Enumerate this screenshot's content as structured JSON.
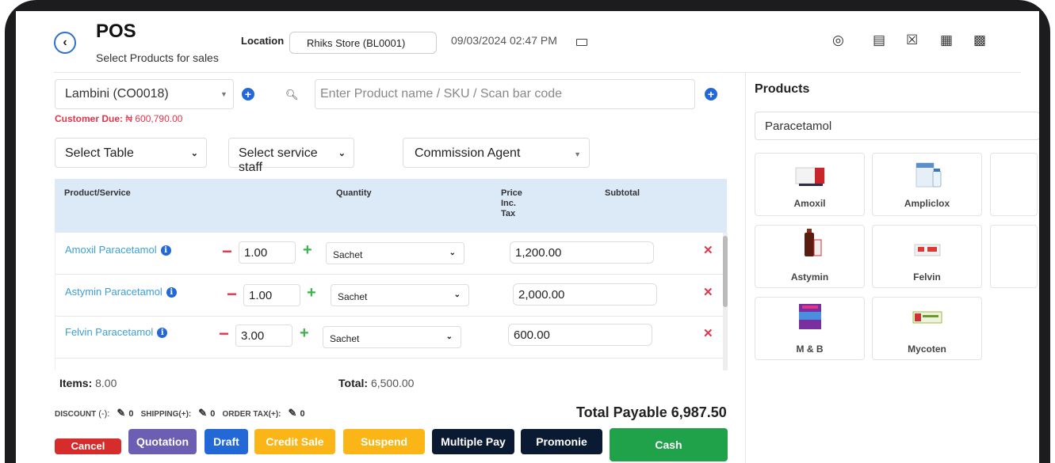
{
  "header": {
    "title": "POS",
    "subtitle": "Select Products for sales",
    "location_label": "Location",
    "location_value": "Rhiks Store (BL0001)",
    "datetime": "09/03/2024 02:47 PM"
  },
  "customer": {
    "selected": "Lambini (CO0018)",
    "due_label": "Customer Due:",
    "due_value": "₦ 600,790.00"
  },
  "search": {
    "placeholder": "Enter Product name / SKU / Scan bar code"
  },
  "selects": {
    "table": "Select Table",
    "service_staff": "Select service staff",
    "commission_agent": "Commission Agent"
  },
  "table": {
    "headers": {
      "product": "Product/Service",
      "quantity": "Quantity",
      "price": "Price\nInc.\nTax",
      "subtotal": "Subtotal"
    },
    "rows": [
      {
        "name": "Amoxil Paracetamol",
        "qty": "1.00",
        "unit": "Sachet",
        "price": "1,200.00"
      },
      {
        "name": "Astymin Paracetamol",
        "qty": "1.00",
        "unit": "Sachet",
        "price": "2,000.00"
      },
      {
        "name": "Felvin Paracetamol",
        "qty": "3.00",
        "unit": "Sachet",
        "price": "600.00"
      }
    ]
  },
  "totals": {
    "items_label": "Items:",
    "items_value": "8.00",
    "total_label": "Total:",
    "total_value": "6,500.00",
    "discount_label": "DISCOUNT",
    "discount_sign": "(-):",
    "discount_value": "0",
    "shipping_label": "SHIPPING(+):",
    "shipping_value": "0",
    "order_tax_label": "ORDER TAX(+):",
    "order_tax_value": "0",
    "total_payable": "Total Payable 6,987.50"
  },
  "buttons": {
    "cancel": "Cancel",
    "quotation": "Quotation",
    "draft": "Draft",
    "credit_sale": "Credit Sale",
    "suspend": "Suspend",
    "multiple_pay": "Multiple Pay",
    "promonie": "Promonie",
    "cash": "Cash"
  },
  "products": {
    "title": "Products",
    "search_value": "Paracetamol",
    "items": [
      {
        "name": "Amoxil"
      },
      {
        "name": "Ampliclox"
      },
      {
        "name": "Astymin"
      },
      {
        "name": "Felvin"
      },
      {
        "name": "M & B"
      },
      {
        "name": "Mycoten"
      }
    ]
  },
  "icons": {
    "back": "chevron-left-icon",
    "keyboard": "keyboard-icon",
    "header_actions": [
      "eye-icon",
      "receipt-icon",
      "bag-icon",
      "register-icon",
      "calculator-icon"
    ]
  },
  "colors": {
    "primary": "#2268d6",
    "cancel": "#d62c2c",
    "quotation": "#6c5fb3",
    "draft": "#2268d6",
    "credit_sale": "#fbb516",
    "suspend": "#fbb516",
    "dark": "#0b1a33",
    "cash": "#1fa24a",
    "danger_text": "#e0364c"
  }
}
